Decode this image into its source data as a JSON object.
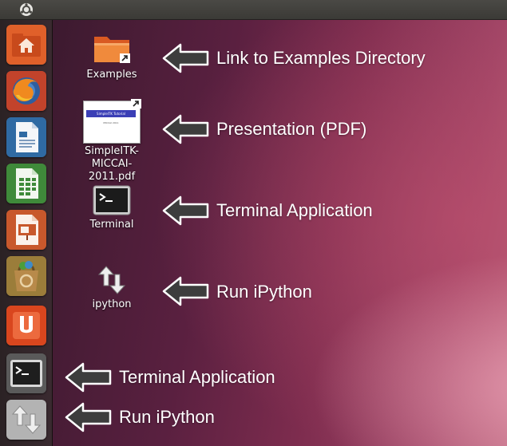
{
  "desktop_icons": [
    {
      "label": "Examples",
      "icon": "folder-link-icon"
    },
    {
      "label": "SimpleITK-MICCAI-\n2011.pdf",
      "icon": "pdf-document-icon",
      "thumb_title": "SimpleITK Tutorial",
      "thumb_sub": "MICCAI 2011"
    },
    {
      "label": "Terminal",
      "icon": "terminal-icon"
    },
    {
      "label": "ipython",
      "icon": "up-down-arrows-icon"
    }
  ],
  "annotations": [
    "Link to Examples Directory",
    "Presentation (PDF)",
    "Terminal Application",
    "Run iPython",
    "Terminal Application",
    "Run iPython"
  ],
  "launcher_items": [
    {
      "name": "home-folder",
      "icon": "home-folder-icon",
      "color": "#e0602a"
    },
    {
      "name": "firefox",
      "icon": "firefox-icon",
      "color": "#c2432b"
    },
    {
      "name": "writer",
      "icon": "document-writer-icon",
      "color": "#2f6aa3"
    },
    {
      "name": "calc",
      "icon": "spreadsheet-calc-icon",
      "color": "#3f8a3a"
    },
    {
      "name": "impress",
      "icon": "presentation-impress-icon",
      "color": "#c8582c"
    },
    {
      "name": "software-center",
      "icon": "software-center-icon",
      "color": "#9b7d3a"
    },
    {
      "name": "ubuntu-one",
      "icon": "ubuntu-one-icon",
      "color": "#d9461e"
    },
    {
      "name": "terminal",
      "icon": "terminal-icon",
      "color": "#3a3a3a"
    },
    {
      "name": "ipython",
      "icon": "up-down-arrows-icon",
      "color": "#b9b9b9"
    }
  ]
}
